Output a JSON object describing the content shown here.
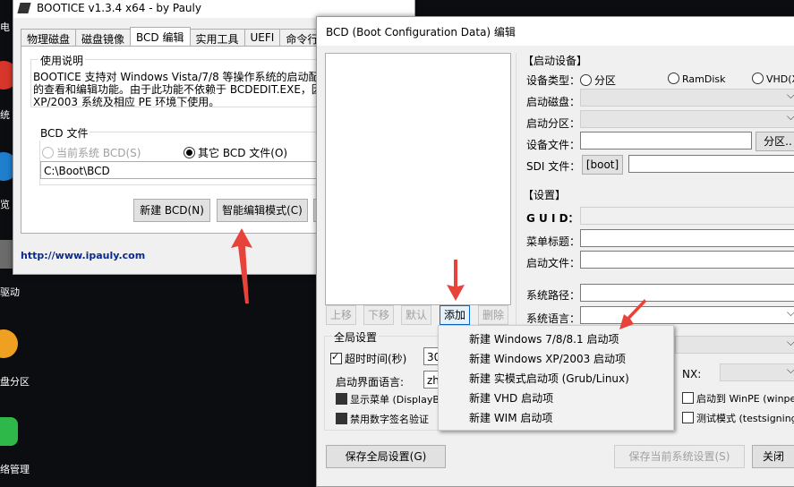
{
  "desktop": {
    "items": [
      {
        "label": "电"
      },
      {
        "label": "统"
      },
      {
        "label": "览"
      },
      {
        "label": "驱动"
      },
      {
        "label": "盘分区"
      },
      {
        "label": "络管理"
      }
    ]
  },
  "main_window": {
    "title": "BOOTICE v1.3.4 x64 - by Pauly",
    "tabs": [
      "物理磁盘",
      "磁盘镜像",
      "BCD 编辑",
      "实用工具",
      "UEFI",
      "命令行参"
    ],
    "usage_legend": "使用说明",
    "usage_text_1": "BOOTICE 支持对 Windows Vista/7/8 等操作系统的启动配置数",
    "usage_text_2": "的查看和编辑功能。由于此功能不依赖于 BCDEDIT.EXE，因",
    "usage_text_3": "XP/2003 系统及相应 PE 环境下使用。",
    "bcd_legend": "BCD 文件",
    "radio_current": "当前系统 BCD(S)",
    "radio_other": "其它 BCD 文件(O)",
    "bcd_path": "C:\\Boot\\BCD",
    "btn_new": "新建 BCD(N)",
    "btn_smart": "智能编辑模式(C)",
    "btn_adv": "高",
    "url": "http://www.ipauly.com"
  },
  "bcd_window": {
    "title": "BCD (Boot Configuration Data) 编辑",
    "boot_device_header": "【启动设备】",
    "device_type_label": "设备类型：",
    "opt_partition": "分区",
    "opt_ramdisk": "RamDisk",
    "opt_vhd": "VHD(X)",
    "boot_disk_label": "启动磁盘：",
    "boot_partition_label": "启动分区：",
    "device_file_label": "设备文件：",
    "btn_partition": "分区..",
    "sdi_label": "SDI 文件：",
    "btn_boot": "[boot]",
    "settings_header": "【设置】",
    "guid_label": "G U I D：",
    "menu_title_label": "菜单标题：",
    "boot_file_label": "启动文件：",
    "system_path_label": "系统路径：",
    "system_lang_label": "系统语言：",
    "btn_up": "上移",
    "btn_down": "下移",
    "btn_default": "默认",
    "btn_add": "添加",
    "btn_delete": "删除",
    "global_legend": "全局设置",
    "timeout_label": "超时时间(秒)",
    "timeout_value": "30",
    "ui_lang_label": "启动界面语言:",
    "ui_lang_value": "zh-",
    "show_menu_label": "显示菜单 (DisplayBo",
    "disable_sig_label": "禁用数字签名验证",
    "nx_label": "NX:",
    "winpe_label": "启动到 WinPE (winpe)",
    "testsign_label": "测试模式 (testsigning)",
    "btn_save_global": "保存全局设置(G)",
    "btn_save_current": "保存当前系统设置(S)",
    "btn_close": "关闭"
  },
  "context_menu": {
    "items": [
      "新建 Windows 7/8/8.1 启动项",
      "新建 Windows XP/2003 启动项",
      "新建 实模式启动项 (Grub/Linux)",
      "新建 VHD 启动项",
      "新建 WIM 启动项"
    ]
  },
  "colors": {
    "desktop_bg": "#0b0d11",
    "arrow": "#e8433a",
    "window_bg": "#f0f0f0",
    "link": "#0a2a8a"
  }
}
